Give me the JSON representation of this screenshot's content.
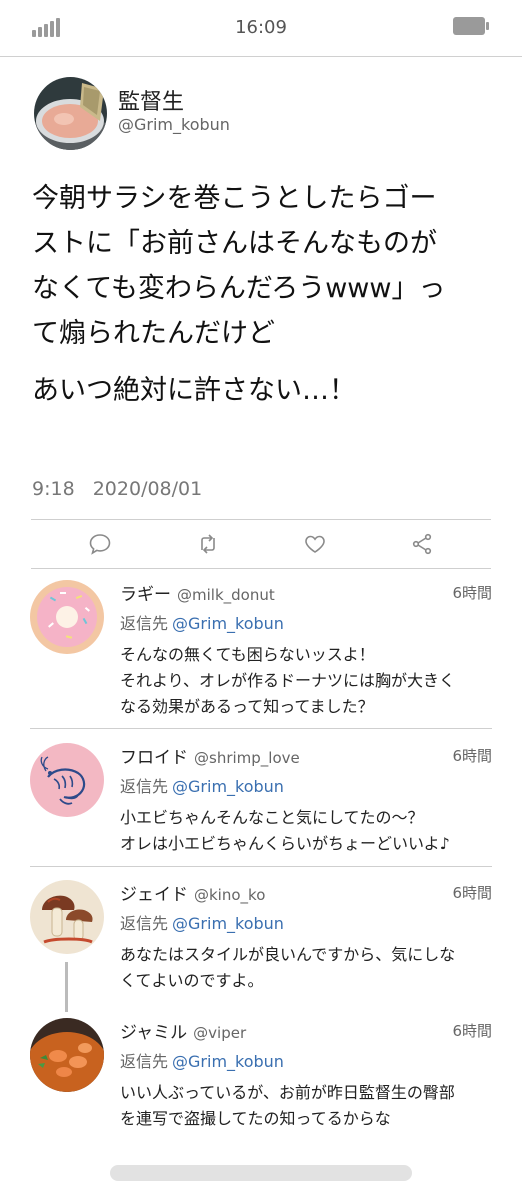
{
  "status_bar": {
    "time": "16:09",
    "signal_icon": "signal-icon",
    "battery_icon": "battery-icon"
  },
  "tweet": {
    "author": {
      "name": "監督生",
      "handle": "@Grim_kobun",
      "avatar": "canned-tuna-avatar"
    },
    "text_lines": [
      "今朝サラシを巻こうとしたらゴー",
      "ストに「お前さんはそんなものが",
      "なくても変わらんだろうwww」っ",
      "て煽られたんだけど",
      "あいつ絶対に許さない…！"
    ],
    "time": "9:18",
    "date": "2020/08/01",
    "actions": [
      "reply-icon",
      "retweet-icon",
      "like-icon",
      "share-icon"
    ]
  },
  "replies": [
    {
      "name": "ラギー",
      "handle": "@milk_donut",
      "time": "6時間",
      "to_label": "返信先",
      "to_handle": "@Grim_kobun",
      "text_lines": [
        "そんなの無くても困らないッスよ！",
        "それより、オレが作るドーナツには胸が大きく",
        "なる効果があるって知ってました？"
      ],
      "avatar": "donut-avatar"
    },
    {
      "name": "フロイド",
      "handle": "@shrimp_love",
      "time": "6時間",
      "to_label": "返信先",
      "to_handle": "@Grim_kobun",
      "text_lines": [
        "小エビちゃんそんなこと気にしてたの〜？",
        "オレは小エビちゃんくらいがちょーどいいよ♪"
      ],
      "avatar": "shrimp-avatar"
    },
    {
      "name": "ジェイド",
      "handle": "@kino_ko",
      "time": "6時間",
      "to_label": "返信先",
      "to_handle": "@Grim_kobun",
      "text_lines": [
        "あなたはスタイルが良いんですから、気にしな",
        "くてよいのですよ。"
      ],
      "avatar": "mushroom-avatar"
    },
    {
      "name": "ジャミル",
      "handle": "@viper",
      "time": "6時間",
      "to_label": "返信先",
      "to_handle": "@Grim_kobun",
      "text_lines": [
        "いい人ぶっているが、お前が昨日監督生の臀部",
        "を連写で盗撮してたの知ってるからな"
      ],
      "avatar": "curry-avatar"
    }
  ],
  "colors": {
    "mention": "#3a6fb0",
    "divider": "#cfcfcf",
    "icon_gray": "#9a9a9a"
  }
}
